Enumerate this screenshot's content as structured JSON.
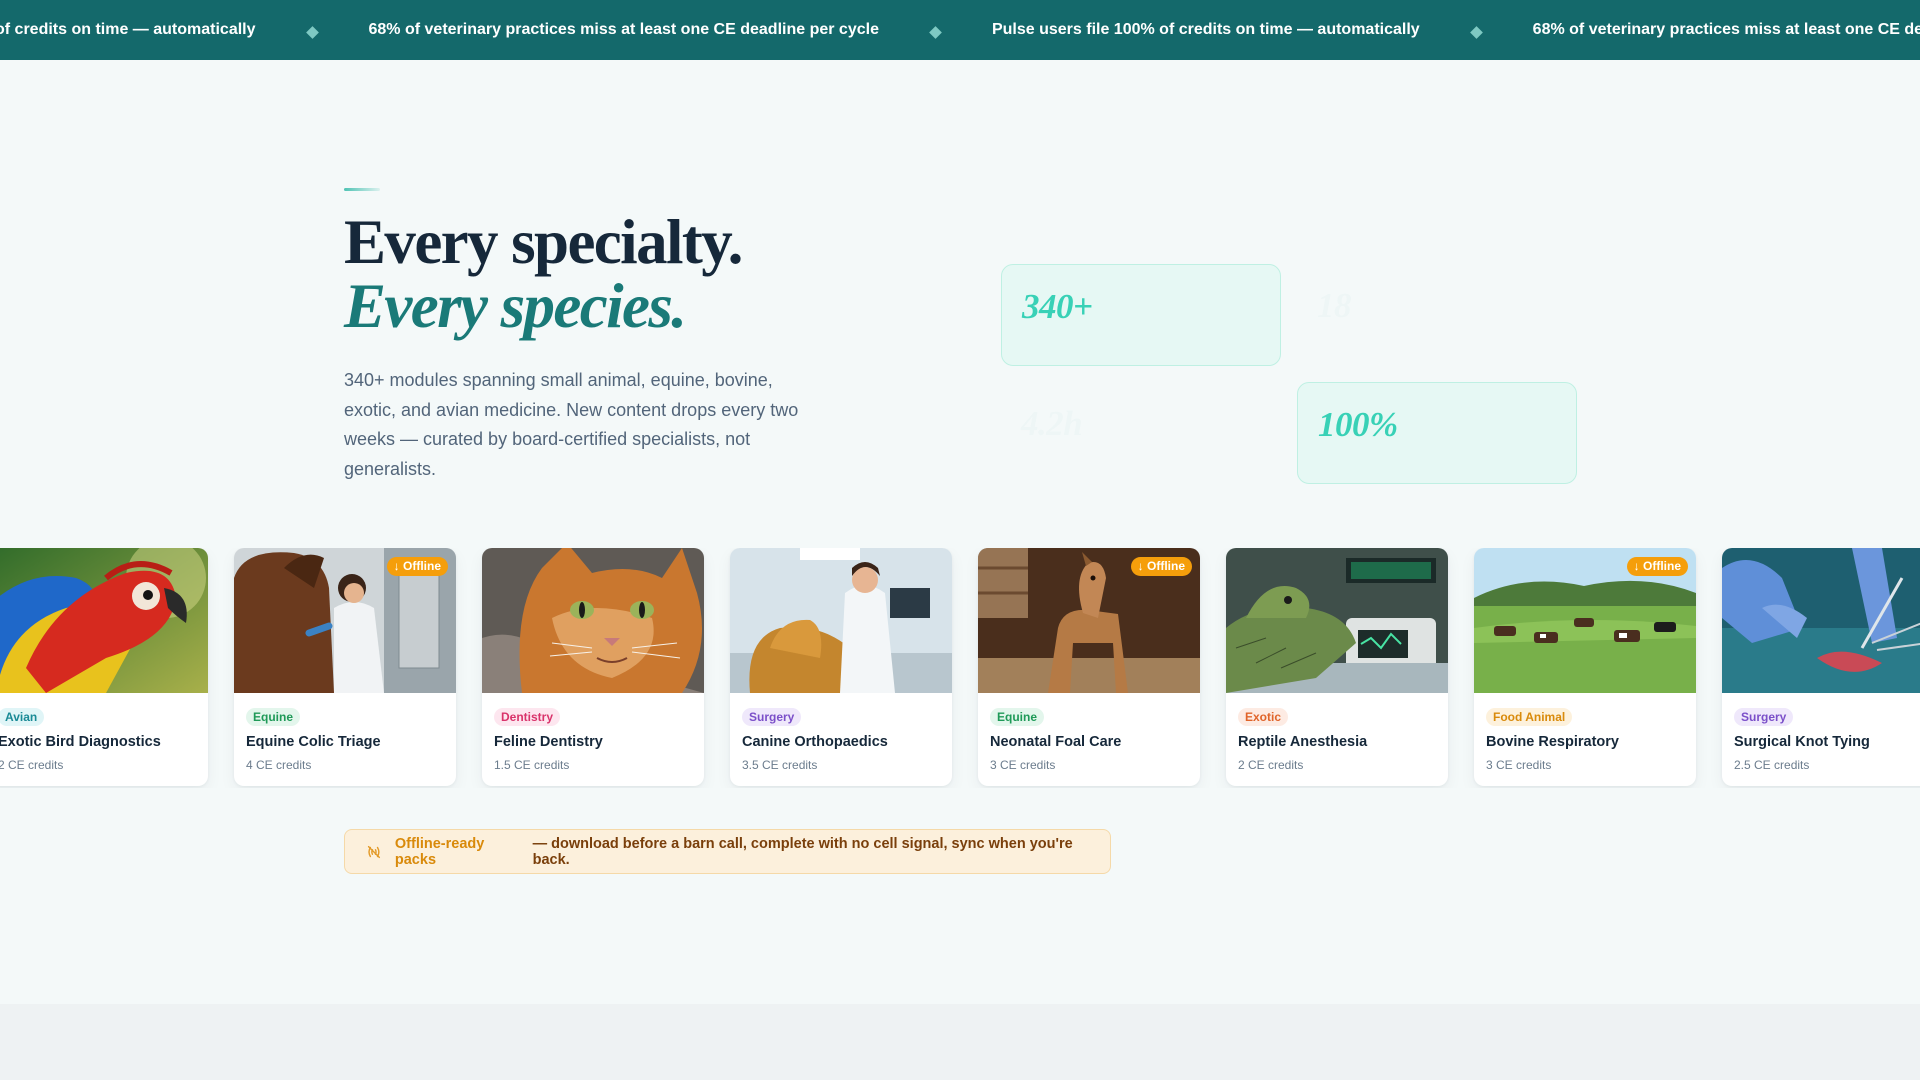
{
  "ticker": {
    "items": [
      "of credits on time — automatically",
      "68% of veterinary practices miss at least one CE deadline per cycle",
      "Pulse users file 100% of credits on time — automatically",
      "68% of veterinary practices miss at least one CE deadline per cycle"
    ]
  },
  "hero": {
    "title_line1": "Every specialty.",
    "title_line2": "Every species.",
    "description": "340+ modules spanning small animal, equine, bovine, exotic, and avian medicine. New content drops every two weeks — curated by board-certified specialists, not generalists."
  },
  "stats": [
    {
      "value": "340+",
      "style": "filled"
    },
    {
      "value": "18",
      "style": "ghost"
    },
    {
      "value": "4.2h",
      "style": "ghost"
    },
    {
      "value": "100%",
      "style": "filled"
    }
  ],
  "cards": [
    {
      "tag": "Avian",
      "tag_bg": "#e0f5f7",
      "tag_color": "#1a8a96",
      "title": "Exotic Bird Diagnostics",
      "credits": "2 CE credits",
      "offline": false,
      "image": "parrot-icon"
    },
    {
      "tag": "Equine",
      "tag_bg": "#e3f6ec",
      "tag_color": "#1f9a58",
      "title": "Equine Colic Triage",
      "credits": "4 CE credits",
      "offline": true,
      "image": "horse-vet-icon"
    },
    {
      "tag": "Dentistry",
      "tag_bg": "#fde6ef",
      "tag_color": "#d9336b",
      "title": "Feline Dentistry",
      "credits": "1.5 CE credits",
      "offline": false,
      "image": "cat-icon"
    },
    {
      "tag": "Surgery",
      "tag_bg": "#efe8fb",
      "tag_color": "#7b4fc9",
      "title": "Canine Orthopaedics",
      "credits": "3.5 CE credits",
      "offline": false,
      "image": "dog-vet-icon"
    },
    {
      "tag": "Equine",
      "tag_bg": "#e3f6ec",
      "tag_color": "#1f9a58",
      "title": "Neonatal Foal Care",
      "credits": "3 CE credits",
      "offline": true,
      "image": "foal-icon"
    },
    {
      "tag": "Exotic",
      "tag_bg": "#fdebe3",
      "tag_color": "#e0642a",
      "title": "Reptile Anesthesia",
      "credits": "2 CE credits",
      "offline": false,
      "image": "iguana-icon"
    },
    {
      "tag": "Food Animal",
      "tag_bg": "#fdf1dc",
      "tag_color": "#d98a0b",
      "title": "Bovine Respiratory",
      "credits": "3 CE credits",
      "offline": true,
      "image": "cattle-field-icon"
    },
    {
      "tag": "Surgery",
      "tag_bg": "#efe8fb",
      "tag_color": "#7b4fc9",
      "title": "Surgical Knot Tying",
      "credits": "2.5 CE credits",
      "offline": false,
      "image": "surgery-hands-icon"
    }
  ],
  "offline_badge_label": "↓ Offline",
  "offline_banner": {
    "strong": "Offline-ready packs",
    "rest": "— download before a barn call, complete with no cell signal, sync when you're back."
  },
  "colors": {
    "brand_teal": "#14696b",
    "accent_mint": "#38d1b6",
    "offline_orange": "#f59e0b"
  }
}
